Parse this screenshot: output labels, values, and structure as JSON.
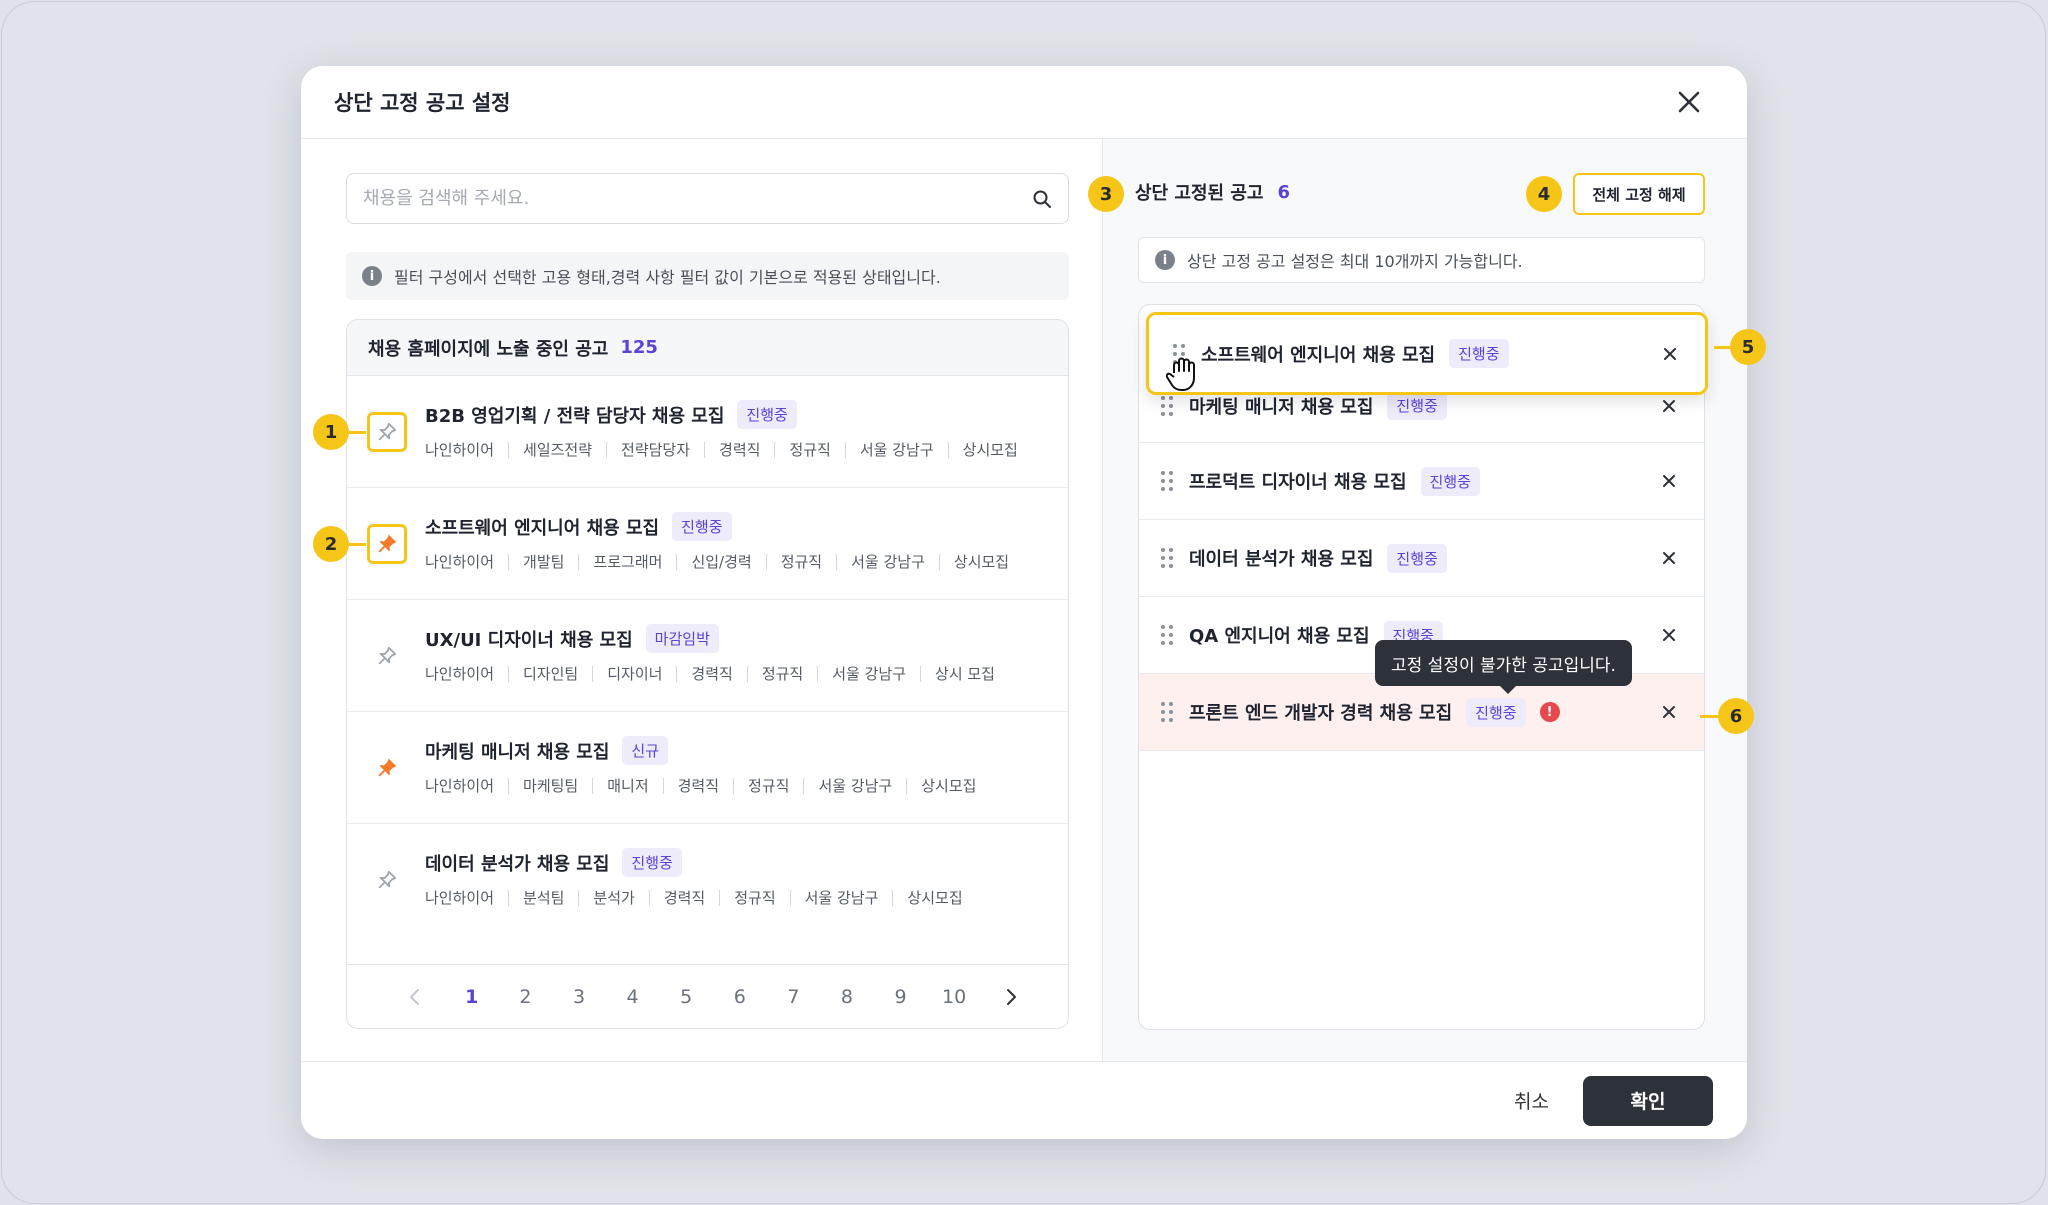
{
  "modal": {
    "title": "상단 고정 공고 설정",
    "cancel_label": "취소",
    "confirm_label": "확인"
  },
  "left": {
    "search_placeholder": "채용을 검색해 주세요.",
    "info_text": "필터 구성에서 선택한 고용 형태,경력 사항 필터 값이 기본으로 적용된 상태입니다.",
    "list_title": "채용 홈페이지에 노출 중인 공고",
    "list_count": "125",
    "jobs": [
      {
        "title": "B2B 영업기획 / 전략 담당자 채용 모집",
        "badge": "진행중",
        "tags": [
          "나인하이어",
          "세일즈전략",
          "전략담당자",
          "경력직",
          "정규직",
          "서울 강남구",
          "상시모집"
        ],
        "pinned": false
      },
      {
        "title": "소프트웨어 엔지니어 채용 모집",
        "badge": "진행중",
        "tags": [
          "나인하이어",
          "개발팀",
          "프로그래머",
          "신입/경력",
          "정규직",
          "서울 강남구",
          "상시모집"
        ],
        "pinned": true
      },
      {
        "title": "UX/UI 디자이너 채용 모집",
        "badge": "마감임박",
        "tags": [
          "나인하이어",
          "디자인팀",
          "디자이너",
          "경력직",
          "정규직",
          "서울 강남구",
          "상시 모집"
        ],
        "pinned": false
      },
      {
        "title": "마케팅 매니저 채용 모집",
        "badge": "신규",
        "tags": [
          "나인하이어",
          "마케팅팀",
          "매니저",
          "경력직",
          "정규직",
          "서울 강남구",
          "상시모집"
        ],
        "pinned": true
      },
      {
        "title": "데이터 분석가 채용 모집",
        "badge": "진행중",
        "tags": [
          "나인하이어",
          "분석팀",
          "분석가",
          "경력직",
          "정규직",
          "서울 강남구",
          "상시모집"
        ],
        "pinned": false
      }
    ],
    "pages": [
      "1",
      "2",
      "3",
      "4",
      "5",
      "6",
      "7",
      "8",
      "9",
      "10"
    ],
    "active_page": "1"
  },
  "right": {
    "title": "상단 고정된 공고",
    "count": "6",
    "unpin_all_label": "전체 고정 해제",
    "info_text": "상단 고정 공고 설정은 최대 10개까지 가능합니다.",
    "dragging_item": {
      "title": "소프트웨어 엔지니어 채용 모집",
      "badge": "진행중"
    },
    "items": [
      {
        "title": "마케팅 매니저 채용 모집",
        "badge": "진행중"
      },
      {
        "title": "프로덕트 디자이너 채용 모집",
        "badge": "진행중"
      },
      {
        "title": "데이터 분석가 채용 모집",
        "badge": "진행중"
      },
      {
        "title": "QA 엔지니어 채용 모집",
        "badge": "진행중"
      },
      {
        "title": "프론트 엔드 개발자 경력 채용 모집",
        "badge": "진행중",
        "error": true
      }
    ],
    "tooltip": "고정 설정이 불가한 공고입니다."
  },
  "markers": [
    "1",
    "2",
    "3",
    "4",
    "5",
    "6"
  ],
  "colors": {
    "accent": "#5b43d6",
    "highlight": "#f5c518",
    "error": "#e5484d",
    "dark_button": "#2d3139",
    "error_row": "#fdf0ef"
  }
}
